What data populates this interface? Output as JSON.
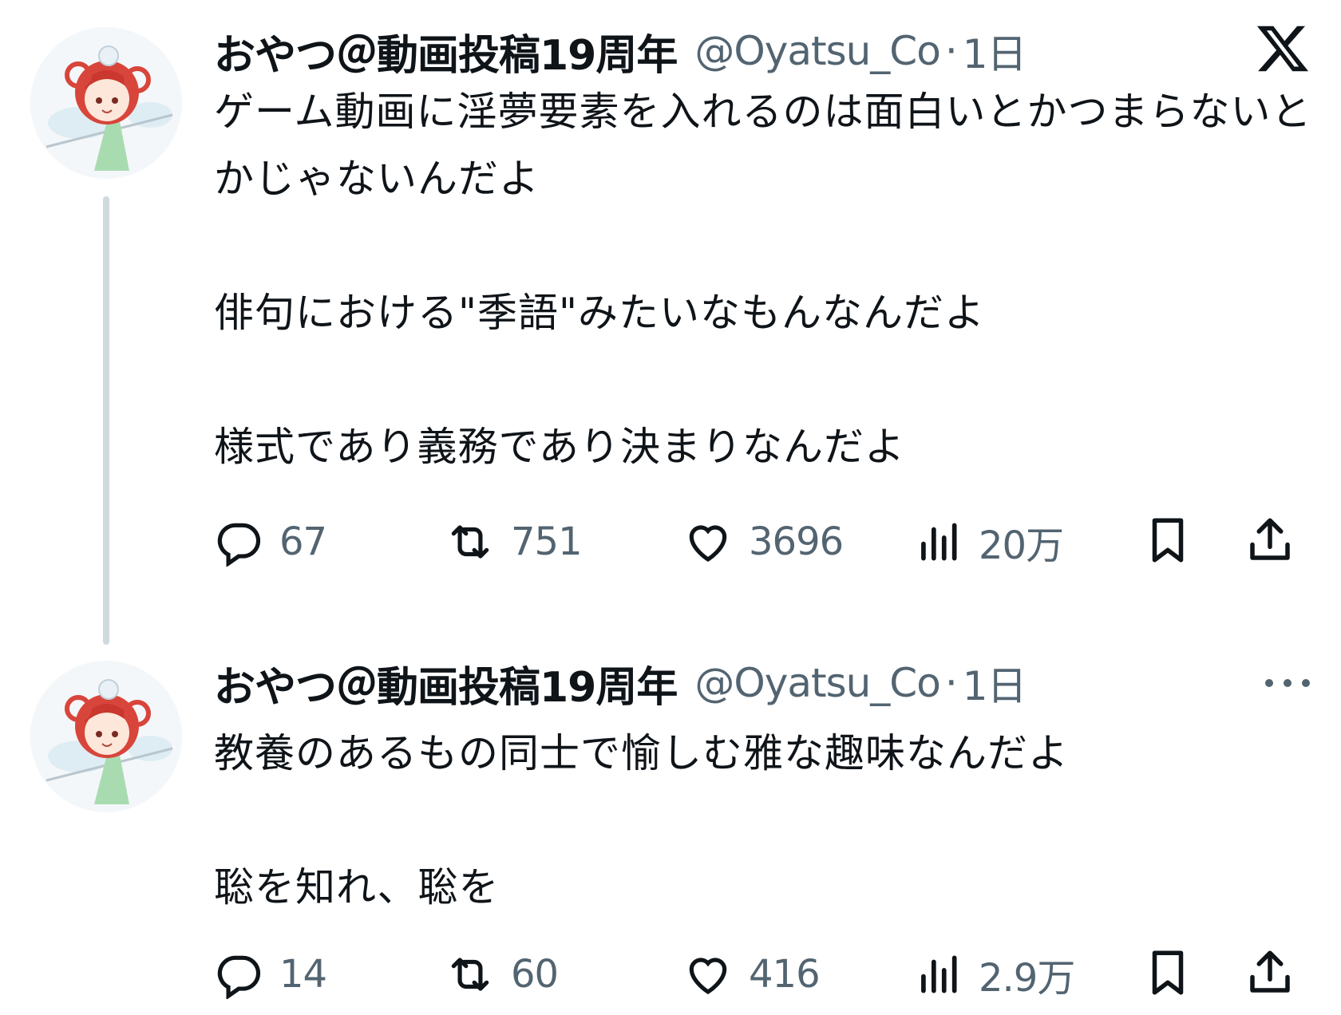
{
  "tweets": [
    {
      "author_name": "おやつ＠動画投稿19周年",
      "handle": "@Oyatsu_Co",
      "separator": "·",
      "time": "1日",
      "header_icon": "x-logo-icon",
      "paragraphs": [
        "ゲーム動画に淫夢要素を入れるのは面白いとかつまらないとかじゃないんだよ",
        "俳句における\"季語\"みたいなもんなんだよ",
        "様式であり義務であり決まりなんだよ"
      ],
      "reply_count": "67",
      "retweet_count": "751",
      "like_count": "3696",
      "view_count": "20万"
    },
    {
      "author_name": "おやつ＠動画投稿19周年",
      "handle": "@Oyatsu_Co",
      "separator": "·",
      "time": "1日",
      "header_icon": "more-icon",
      "paragraphs": [
        "教養のあるもの同士で愉しむ雅な趣味なんだよ",
        "聡を知れ、聡を"
      ],
      "reply_count": "14",
      "retweet_count": "60",
      "like_count": "416",
      "view_count": "2.9万"
    }
  ],
  "colors": {
    "text": "#0f1419",
    "muted": "#536471",
    "thread_line": "#cfd9de",
    "background": "#ffffff"
  }
}
